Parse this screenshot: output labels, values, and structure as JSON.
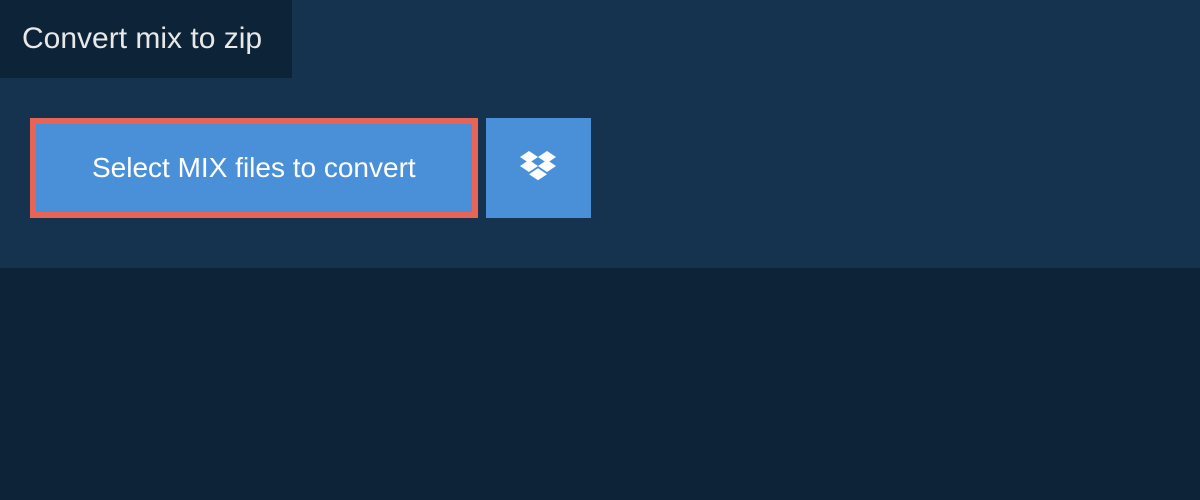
{
  "header": {
    "title": "Convert mix to zip"
  },
  "actions": {
    "select_label": "Select MIX files to convert",
    "dropbox_icon": "dropbox"
  },
  "colors": {
    "panel_bg": "#15334f",
    "page_bg": "#0d2438",
    "button_bg": "#4a90d9",
    "highlight_border": "#e86457",
    "text_light": "#ffffff"
  }
}
